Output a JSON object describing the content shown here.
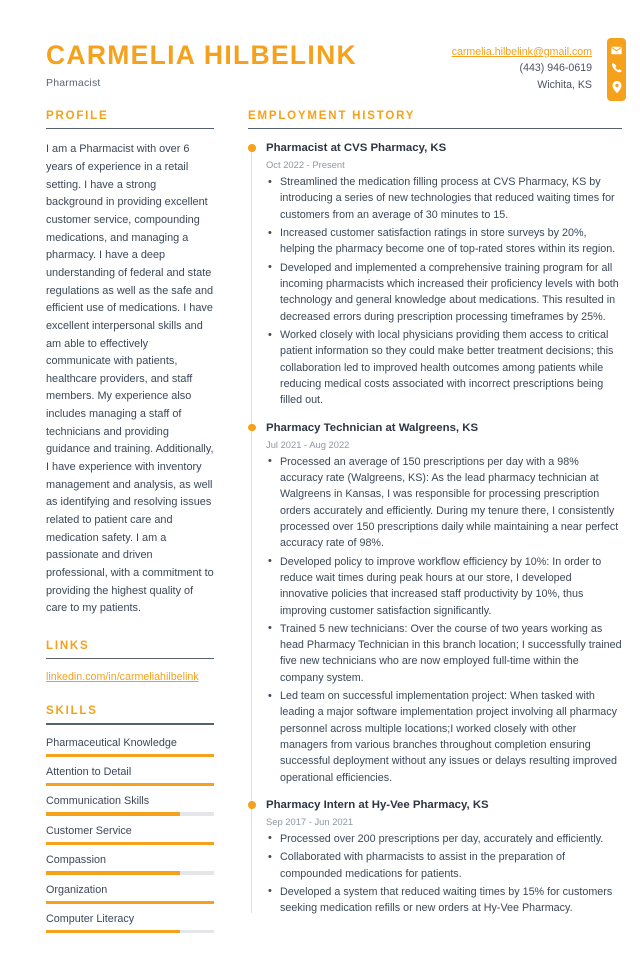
{
  "header": {
    "full_name": "CARMELIA HILBELINK",
    "job_title": "Pharmacist",
    "email": "carmelia.hilbelink@gmail.com",
    "phone": "(443) 946-0619",
    "location": "Wichita, KS",
    "icons": [
      "envelope-icon",
      "phone-icon",
      "location-pin-icon"
    ],
    "accent_color": "#F5A11B"
  },
  "sidebar": {
    "profile": {
      "title": "PROFILE",
      "text": "I am a Pharmacist with over 6 years of experience in a retail setting. I have a strong background in providing excellent customer service, compounding medications, and managing a pharmacy. I have a deep understanding of federal and state regulations as well as the safe and efficient use of medications. I have excellent interpersonal skills and am able to effectively communicate with patients, healthcare providers, and staff members. My experience also includes managing a staff of technicians and providing guidance and training. Additionally, I have experience with inventory management and analysis, as well as identifying and resolving issues related to patient care and medication safety. I am a passionate and driven professional, with a commitment to providing the highest quality of care to my patients."
    },
    "links": {
      "title": "LINKS",
      "items": [
        {
          "label": "linkedin.com/in/carmeliahilbelink"
        }
      ]
    },
    "skills": {
      "title": "SKILLS",
      "items": [
        {
          "label": "Pharmaceutical Knowledge",
          "level": 100
        },
        {
          "label": "Attention to Detail",
          "level": 100
        },
        {
          "label": "Communication Skills",
          "level": 80
        },
        {
          "label": "Customer Service",
          "level": 100
        },
        {
          "label": "Compassion",
          "level": 80
        },
        {
          "label": "Organization",
          "level": 100
        },
        {
          "label": "Computer Literacy",
          "level": 80
        }
      ]
    }
  },
  "main": {
    "employment": {
      "title": "EMPLOYMENT HISTORY",
      "jobs": [
        {
          "heading": "Pharmacist at CVS Pharmacy, KS",
          "dates": "Oct 2022 - Present",
          "bullets": [
            "Streamlined the medication filling process at CVS Pharmacy, KS by introducing a series of new technologies that reduced waiting times for customers from an average of 30 minutes to 15.",
            "Increased customer satisfaction ratings in store surveys by 20%, helping the pharmacy become one of top-rated stores within its region.",
            "Developed and implemented a comprehensive training program for all incoming pharmacists which increased their proficiency levels with both technology and general knowledge about medications. This resulted in decreased errors during prescription processing timeframes by 25%.",
            "Worked closely with local physicians providing them access to critical patient information so they could make better treatment decisions; this collaboration led to improved health outcomes among patients while reducing medical costs associated with incorrect prescriptions being filled out."
          ]
        },
        {
          "heading": "Pharmacy Technician at Walgreens, KS",
          "dates": "Jul 2021 - Aug 2022",
          "bullets": [
            "Processed an average of 150 prescriptions per day with a 98% accuracy rate (Walgreens, KS): As the lead pharmacy technician at Walgreens in Kansas, I was responsible for processing prescription orders accurately and efficiently. During my tenure there, I consistently processed over 150 prescriptions daily while maintaining a near perfect accuracy rate of 98%.",
            "Developed policy to improve workflow efficiency by 10%: In order to reduce wait times during peak hours at our store, I developed innovative policies that increased staff productivity by 10%, thus improving customer satisfaction significantly.",
            "Trained 5 new technicians: Over the course of two years working as head Pharmacy Technician in this branch location; I successfully trained five new technicians who are now employed full-time within the company system.",
            "Led team on successful implementation project: When tasked with leading a major software implementation project involving all pharmacy personnel across multiple locations;I worked closely with other managers from various branches throughout completion ensuring successful deployment without any issues or delays resulting improved operational efficiencies."
          ]
        },
        {
          "heading": "Pharmacy Intern at Hy-Vee Pharmacy, KS",
          "dates": "Sep 2017 - Jun 2021",
          "bullets": [
            "Processed over 200 prescriptions per day, accurately and efficiently.",
            "Collaborated with pharmacists to assist in the preparation of compounded medications for patients.",
            "Developed a system that reduced waiting times by 15% for customers seeking medication refills or new orders at Hy-Vee Pharmacy."
          ]
        }
      ]
    }
  }
}
